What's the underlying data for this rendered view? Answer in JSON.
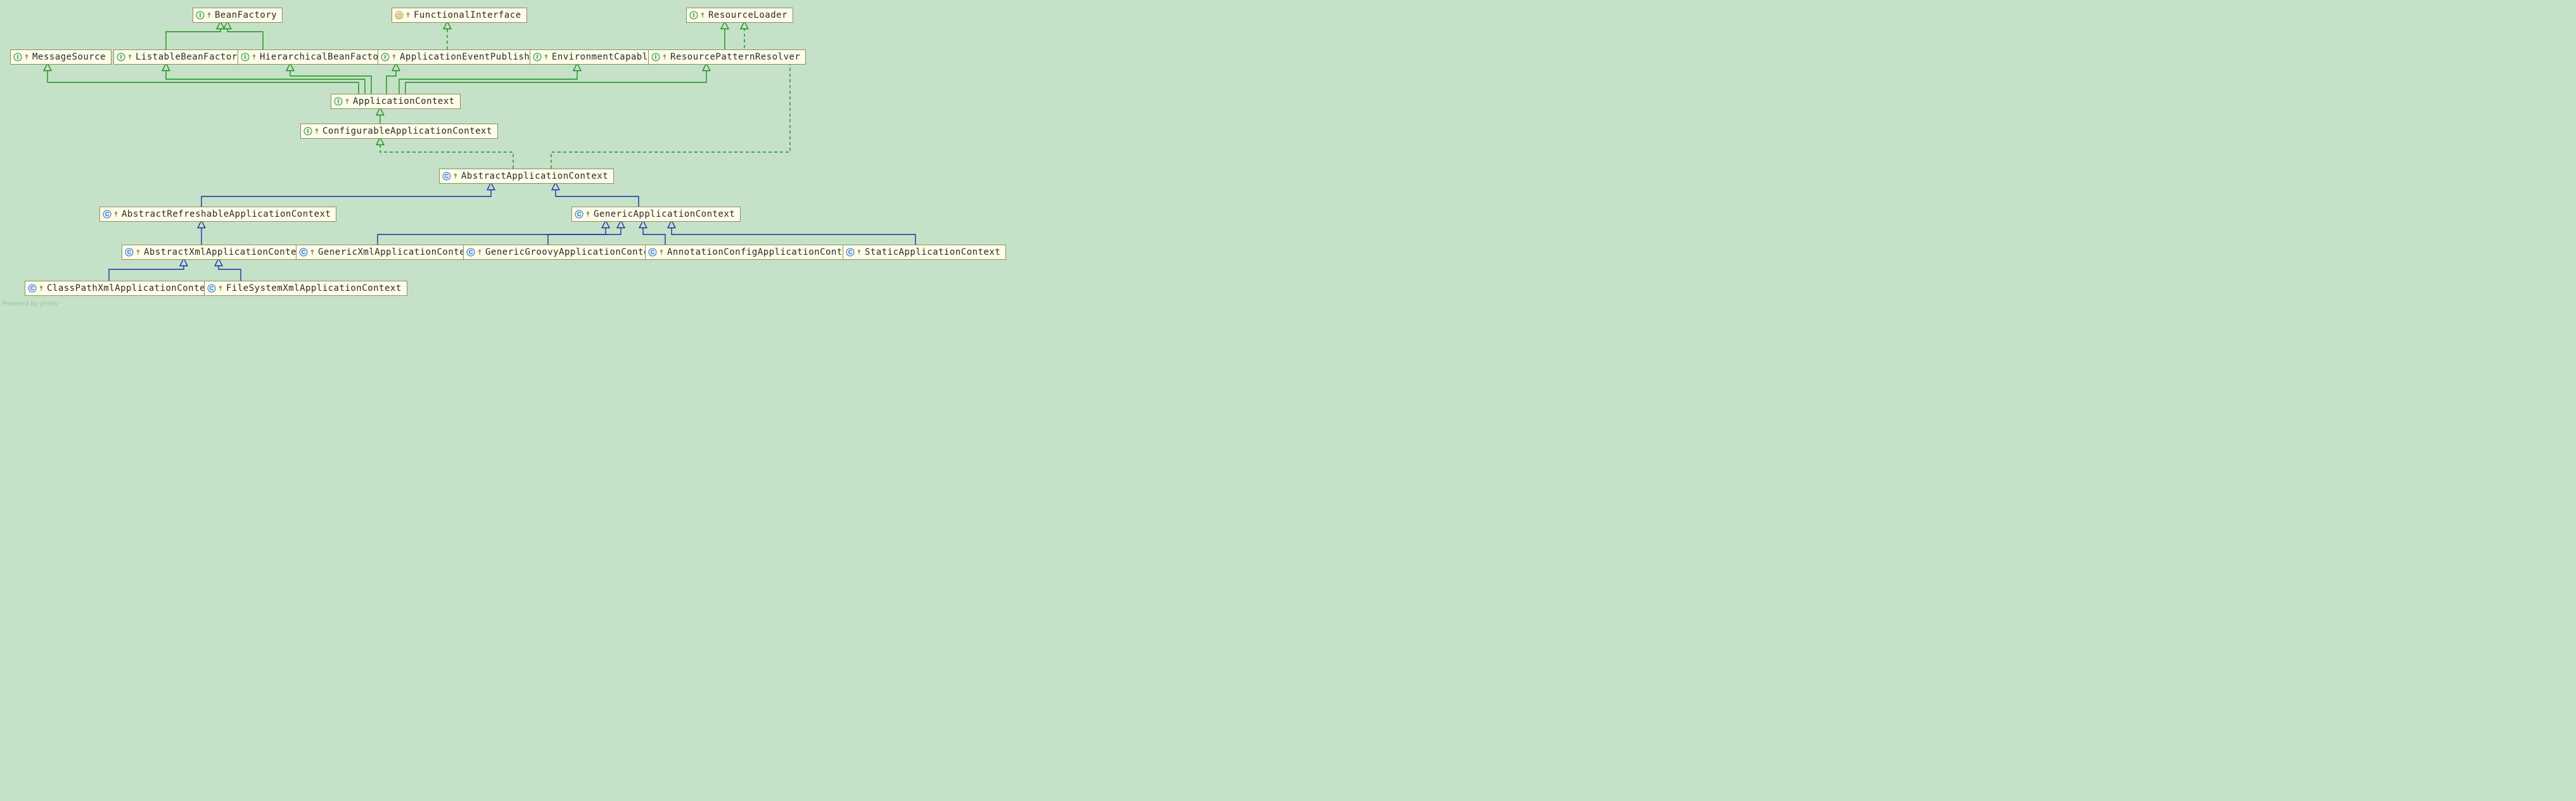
{
  "diagram": {
    "footer": "Powered by yFiles",
    "colors": {
      "background": "#c5e2c8",
      "node_fill": "#fcfce8",
      "node_border": "#8e8e5e",
      "interface_icon": "#2f8a2f",
      "class_icon": "#2a6fb8",
      "extends_edge": "#1830a8",
      "implements_edge": "#1e8e1e"
    },
    "nodes": {
      "BeanFactory": {
        "kind": "interface",
        "label": "BeanFactory"
      },
      "FunctionalInterface": {
        "kind": "annotation",
        "label": "FunctionalInterface"
      },
      "ResourceLoader": {
        "kind": "interface",
        "label": "ResourceLoader"
      },
      "MessageSource": {
        "kind": "interface",
        "label": "MessageSource"
      },
      "ListableBeanFactory": {
        "kind": "interface",
        "label": "ListableBeanFactory"
      },
      "HierarchicalBeanFactory": {
        "kind": "interface",
        "label": "HierarchicalBeanFactory"
      },
      "ApplicationEventPublisher": {
        "kind": "interface",
        "label": "ApplicationEventPublisher"
      },
      "EnvironmentCapable": {
        "kind": "interface",
        "label": "EnvironmentCapable"
      },
      "ResourcePatternResolver": {
        "kind": "interface",
        "label": "ResourcePatternResolver"
      },
      "ApplicationContext": {
        "kind": "interface",
        "label": "ApplicationContext"
      },
      "ConfigurableApplicationContext": {
        "kind": "interface",
        "label": "ConfigurableApplicationContext"
      },
      "AbstractApplicationContext": {
        "kind": "class",
        "label": "AbstractApplicationContext"
      },
      "AbstractRefreshableApplicationContext": {
        "kind": "class",
        "label": "AbstractRefreshableApplicationContext"
      },
      "GenericApplicationContext": {
        "kind": "class",
        "label": "GenericApplicationContext"
      },
      "AbstractXmlApplicationContext": {
        "kind": "class",
        "label": "AbstractXmlApplicationContext"
      },
      "GenericXmlApplicationContext": {
        "kind": "class",
        "label": "GenericXmlApplicationContext"
      },
      "GenericGroovyApplicationContext": {
        "kind": "class",
        "label": "GenericGroovyApplicationContext"
      },
      "AnnotationConfigApplicationContext": {
        "kind": "class",
        "label": "AnnotationConfigApplicationContext"
      },
      "StaticApplicationContext": {
        "kind": "class",
        "label": "StaticApplicationContext"
      },
      "ClassPathXmlApplicationContext": {
        "kind": "class",
        "label": "ClassPathXmlApplicationContext"
      },
      "FileSystemXmlApplicationContext": {
        "kind": "class",
        "label": "FileSystemXmlApplicationContext"
      }
    },
    "edges": [
      {
        "from": "ListableBeanFactory",
        "to": "BeanFactory",
        "style": "implements"
      },
      {
        "from": "HierarchicalBeanFactory",
        "to": "BeanFactory",
        "style": "implements"
      },
      {
        "from": "ApplicationEventPublisher",
        "to": "FunctionalInterface",
        "style": "implements_dashed"
      },
      {
        "from": "ResourcePatternResolver",
        "to": "ResourceLoader",
        "style": "implements"
      },
      {
        "from": "ApplicationContext",
        "to": "MessageSource",
        "style": "implements"
      },
      {
        "from": "ApplicationContext",
        "to": "ListableBeanFactory",
        "style": "implements"
      },
      {
        "from": "ApplicationContext",
        "to": "HierarchicalBeanFactory",
        "style": "implements"
      },
      {
        "from": "ApplicationContext",
        "to": "ApplicationEventPublisher",
        "style": "implements"
      },
      {
        "from": "ApplicationContext",
        "to": "EnvironmentCapable",
        "style": "implements"
      },
      {
        "from": "ApplicationContext",
        "to": "ResourcePatternResolver",
        "style": "implements"
      },
      {
        "from": "ConfigurableApplicationContext",
        "to": "ApplicationContext",
        "style": "implements"
      },
      {
        "from": "AbstractApplicationContext",
        "to": "ConfigurableApplicationContext",
        "style": "implements_dashed"
      },
      {
        "from": "AbstractApplicationContext",
        "to": "ResourceLoader",
        "style": "implements_dashed"
      },
      {
        "from": "AbstractRefreshableApplicationContext",
        "to": "AbstractApplicationContext",
        "style": "extends"
      },
      {
        "from": "GenericApplicationContext",
        "to": "AbstractApplicationContext",
        "style": "extends"
      },
      {
        "from": "AbstractXmlApplicationContext",
        "to": "AbstractRefreshableApplicationContext",
        "style": "extends"
      },
      {
        "from": "GenericXmlApplicationContext",
        "to": "GenericApplicationContext",
        "style": "extends"
      },
      {
        "from": "GenericGroovyApplicationContext",
        "to": "GenericApplicationContext",
        "style": "extends"
      },
      {
        "from": "AnnotationConfigApplicationContext",
        "to": "GenericApplicationContext",
        "style": "extends"
      },
      {
        "from": "StaticApplicationContext",
        "to": "GenericApplicationContext",
        "style": "extends"
      },
      {
        "from": "ClassPathXmlApplicationContext",
        "to": "AbstractXmlApplicationContext",
        "style": "extends"
      },
      {
        "from": "FileSystemXmlApplicationContext",
        "to": "AbstractXmlApplicationContext",
        "style": "extends"
      }
    ]
  }
}
